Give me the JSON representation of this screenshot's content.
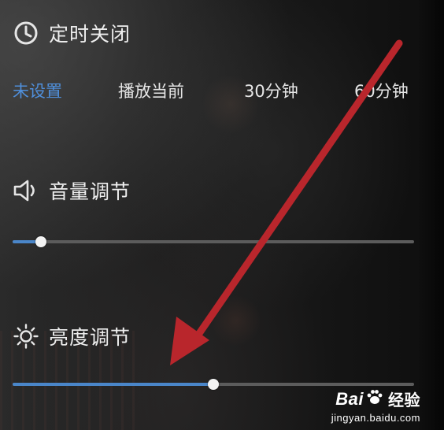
{
  "timer": {
    "title": "定时关闭",
    "options": [
      "未设置",
      "播放当前",
      "30分钟",
      "60分钟"
    ],
    "selected_option": "未设置"
  },
  "volume": {
    "title": "音量调节",
    "level_fraction": 0.07
  },
  "brightness": {
    "title": "亮度调节",
    "level_fraction": 0.5
  },
  "colors": {
    "accent": "#4f8fdb",
    "slider_fill": "#4a86c9",
    "track": "#5c5c5c",
    "annotation_arrow": "#b9262c"
  },
  "icons": {
    "timer": "clock-icon",
    "volume": "speaker-icon",
    "brightness": "sun-icon"
  },
  "watermark": {
    "logo_left": "Bai",
    "logo_right": "经验",
    "url": "jingyan.baidu.com"
  }
}
